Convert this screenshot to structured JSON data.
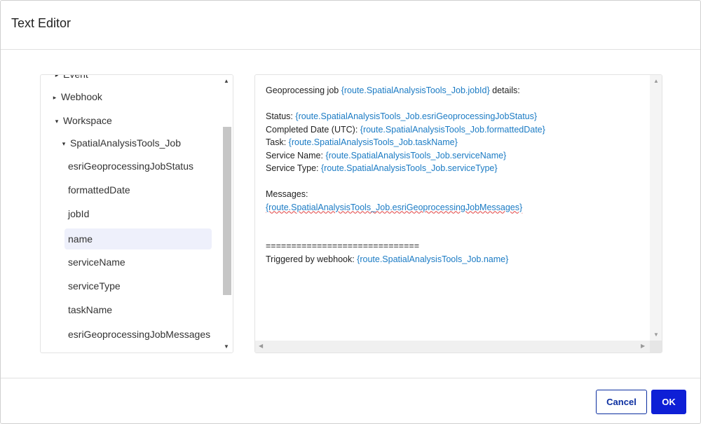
{
  "dialog": {
    "title": "Text Editor"
  },
  "tree": {
    "items": [
      {
        "label": "Event",
        "caret": "▸"
      },
      {
        "label": "Webhook",
        "caret": "▸"
      },
      {
        "label": "Workspace",
        "caret": "▾"
      },
      {
        "label": "SpatialAnalysisTools_Job",
        "caret": "▾"
      },
      {
        "label": "esriGeoprocessingJobStatus"
      },
      {
        "label": "formattedDate"
      },
      {
        "label": "jobId"
      },
      {
        "label": "name"
      },
      {
        "label": "serviceName"
      },
      {
        "label": "serviceType"
      },
      {
        "label": "taskName"
      },
      {
        "label": "esriGeoprocessingJobMessages"
      }
    ],
    "selected": "name"
  },
  "editor": {
    "line1": {
      "pre": "Geoprocessing job ",
      "ref": "{route.SpatialAnalysisTools_Job.jobId}",
      "post": " details:"
    },
    "line2": {
      "pre": "Status: ",
      "ref": "{route.SpatialAnalysisTools_Job.esriGeoprocessingJobStatus}"
    },
    "line3": {
      "pre": "Completed Date (UTC): ",
      "ref": "{route.SpatialAnalysisTools_Job.formattedDate}"
    },
    "line4": {
      "pre": "Task: ",
      "ref": "{route.SpatialAnalysisTools_Job.taskName}"
    },
    "line5": {
      "pre": "Service Name: ",
      "ref": "{route.SpatialAnalysisTools_Job.serviceName}"
    },
    "line6": {
      "pre": "Service Type: ",
      "ref": "{route.SpatialAnalysisTools_Job.serviceType}"
    },
    "line7": {
      "pre": "Messages:"
    },
    "line8": {
      "ref": "{route.SpatialAnalysisTools_Job.esriGeoprocessingJobMessages}"
    },
    "line9": {
      "pre": "=============================="
    },
    "line10": {
      "pre": "Triggered by webhook: ",
      "ref": "{route.SpatialAnalysisTools_Job.name}"
    }
  },
  "footer": {
    "cancel_label": "Cancel",
    "ok_label": "OK"
  },
  "colors": {
    "link": "#1b7bc4",
    "primary": "#0e1fd6",
    "selected_bg": "#eef0fb"
  }
}
